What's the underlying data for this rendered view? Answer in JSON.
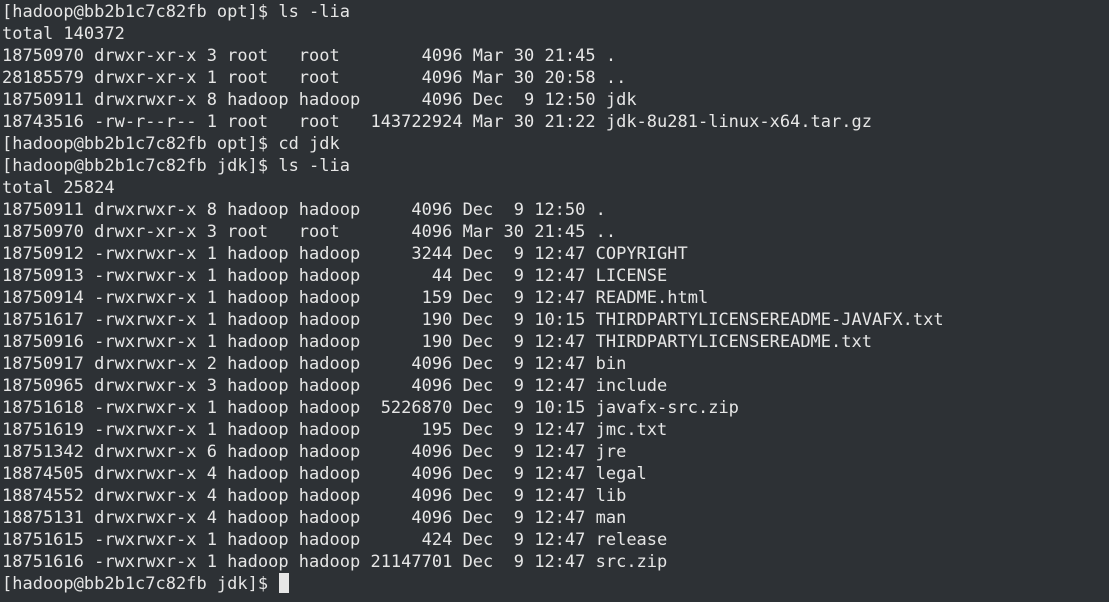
{
  "terminal": {
    "lines": [
      "[hadoop@bb2b1c7c82fb opt]$ ls -lia",
      "total 140372",
      "18750970 drwxr-xr-x 3 root   root        4096 Mar 30 21:45 .",
      "28185579 drwxr-xr-x 1 root   root        4096 Mar 30 20:58 ..",
      "18750911 drwxrwxr-x 8 hadoop hadoop      4096 Dec  9 12:50 jdk",
      "18743516 -rw-r--r-- 1 root   root   143722924 Mar 30 21:22 jdk-8u281-linux-x64.tar.gz",
      "[hadoop@bb2b1c7c82fb opt]$ cd jdk",
      "[hadoop@bb2b1c7c82fb jdk]$ ls -lia",
      "total 25824",
      "18750911 drwxrwxr-x 8 hadoop hadoop     4096 Dec  9 12:50 .",
      "18750970 drwxr-xr-x 3 root   root       4096 Mar 30 21:45 ..",
      "18750912 -rwxrwxr-x 1 hadoop hadoop     3244 Dec  9 12:47 COPYRIGHT",
      "18750913 -rwxrwxr-x 1 hadoop hadoop       44 Dec  9 12:47 LICENSE",
      "18750914 -rwxrwxr-x 1 hadoop hadoop      159 Dec  9 12:47 README.html",
      "18751617 -rwxrwxr-x 1 hadoop hadoop      190 Dec  9 10:15 THIRDPARTYLICENSEREADME-JAVAFX.txt",
      "18750916 -rwxrwxr-x 1 hadoop hadoop      190 Dec  9 12:47 THIRDPARTYLICENSEREADME.txt",
      "18750917 drwxrwxr-x 2 hadoop hadoop     4096 Dec  9 12:47 bin",
      "18750965 drwxrwxr-x 3 hadoop hadoop     4096 Dec  9 12:47 include",
      "18751618 -rwxrwxr-x 1 hadoop hadoop  5226870 Dec  9 10:15 javafx-src.zip",
      "18751619 -rwxrwxr-x 1 hadoop hadoop      195 Dec  9 12:47 jmc.txt",
      "18751342 drwxrwxr-x 6 hadoop hadoop     4096 Dec  9 12:47 jre",
      "18874505 drwxrwxr-x 4 hadoop hadoop     4096 Dec  9 12:47 legal",
      "18874552 drwxrwxr-x 4 hadoop hadoop     4096 Dec  9 12:47 lib",
      "18875131 drwxrwxr-x 4 hadoop hadoop     4096 Dec  9 12:47 man",
      "18751615 -rwxrwxr-x 1 hadoop hadoop      424 Dec  9 12:47 release",
      "18751616 -rwxrwxr-x 1 hadoop hadoop 21147701 Dec  9 12:47 src.zip"
    ],
    "prompt": "[hadoop@bb2b1c7c82fb jdk]$ ",
    "colors": {
      "background": "#2d3135",
      "foreground": "#e6e6e6",
      "cursor": "#e6e6e6"
    }
  }
}
